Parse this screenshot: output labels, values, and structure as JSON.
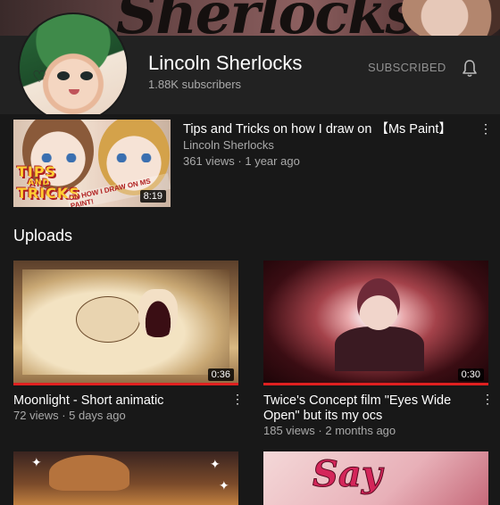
{
  "banner": {
    "text": "Sherlocks"
  },
  "channel": {
    "name": "Lincoln Sherlocks",
    "subscribers": "1.88K subscribers",
    "subscribed_label": "SUBSCRIBED",
    "bell_icon": "bell-icon"
  },
  "featured": {
    "title": "Tips and Tricks on how I draw on 【Ms Paint】",
    "channel": "Lincoln Sherlocks",
    "meta": "361 views · 1 year ago",
    "duration": "8:19",
    "thumb_text_1": "TIPS",
    "thumb_text_2": "AND",
    "thumb_text_3": "TRICKS",
    "thumb_subtext": "ON HOW I DRAW ON MS PAINT!"
  },
  "uploads": {
    "heading": "Uploads",
    "items": [
      {
        "title": "Moonlight - Short animatic",
        "meta": "72 views · 5 days ago",
        "duration": "0:36",
        "watched_fraction": 1.0
      },
      {
        "title": "Twice's Concept film \"Eyes Wide Open\" but its my ocs",
        "meta": "185 views · 2 months ago",
        "duration": "0:30",
        "watched_fraction": 1.0
      },
      {
        "thumb_text": ""
      },
      {
        "thumb_text": "Say"
      }
    ]
  },
  "colors": {
    "background": "#181818",
    "header": "#222222",
    "progress": "#e02020",
    "secondary_text": "#aaaaaa"
  }
}
